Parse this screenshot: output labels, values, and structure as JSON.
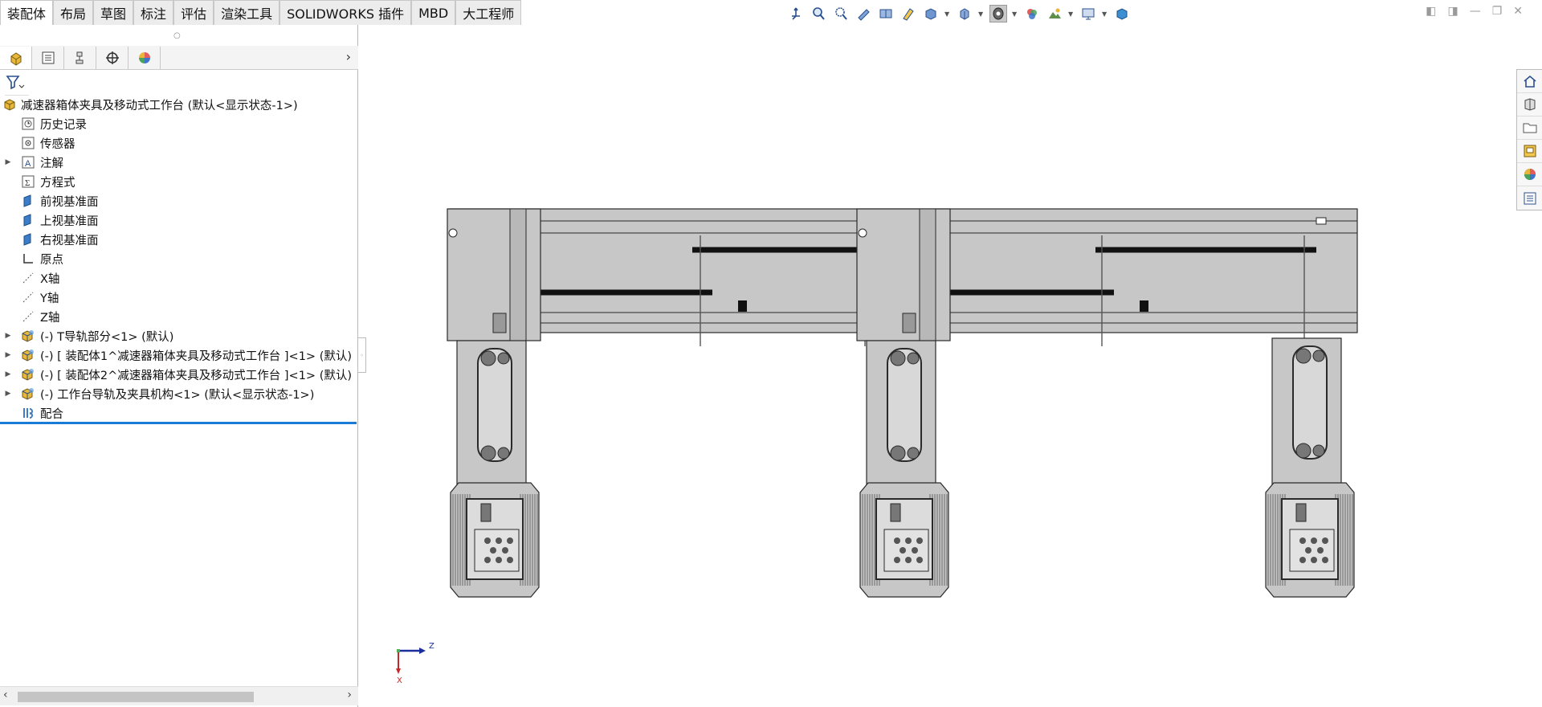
{
  "command_tabs": [
    "装配体",
    "布局",
    "草图",
    "标注",
    "评估",
    "渲染工具",
    "SOLIDWORKS 插件",
    "MBD",
    "大工程师"
  ],
  "heads_up_toolbar": {
    "icons": [
      "view-orientation-icon",
      "zoom-to-fit-icon",
      "zoom-to-area-icon",
      "previous-view-icon",
      "section-view-icon",
      "dynamic-annotation-icon",
      "view-orientation-cube-icon",
      "display-style-icon",
      "hide-show-items-icon",
      "edit-appearance-icon",
      "apply-scene-icon",
      "view-settings-icon",
      "display-pane-icon"
    ]
  },
  "panel": {
    "tabs": [
      "featuremanager-icon",
      "propertymanager-icon",
      "configurationmanager-icon",
      "dimxpertmanager-icon",
      "displaymanager-icon"
    ],
    "tree": {
      "root": "减速器箱体夹具及移动式工作台 (默认<显示状态-1>)",
      "items": [
        {
          "label": "历史记录",
          "icon": "history-icon",
          "expandable": false
        },
        {
          "label": "传感器",
          "icon": "sensor-icon",
          "expandable": false
        },
        {
          "label": "注解",
          "icon": "annotations-icon",
          "expandable": true
        },
        {
          "label": "方程式",
          "icon": "equations-icon",
          "expandable": false
        },
        {
          "label": "前视基准面",
          "icon": "plane-icon",
          "expandable": false
        },
        {
          "label": "上视基准面",
          "icon": "plane-icon",
          "expandable": false
        },
        {
          "label": "右视基准面",
          "icon": "plane-icon",
          "expandable": false
        },
        {
          "label": "原点",
          "icon": "origin-icon",
          "expandable": false
        },
        {
          "label": "X轴",
          "icon": "axis-icon",
          "expandable": false
        },
        {
          "label": "Y轴",
          "icon": "axis-icon",
          "expandable": false
        },
        {
          "label": "Z轴",
          "icon": "axis-icon",
          "expandable": false
        },
        {
          "label": "(-) T导轨部分<1> (默认)",
          "icon": "subassembly-icon",
          "expandable": true
        },
        {
          "label": "(-) [ 装配体1^减速器箱体夹具及移动式工作台 ]<1> (默认)",
          "icon": "subassembly-icon",
          "expandable": true
        },
        {
          "label": "(-) [ 装配体2^减速器箱体夹具及移动式工作台 ]<1> (默认)",
          "icon": "subassembly-icon",
          "expandable": true
        },
        {
          "label": "(-) 工作台导轨及夹具机构<1> (默认<显示状态-1>)",
          "icon": "subassembly-icon",
          "expandable": true
        },
        {
          "label": "配合",
          "icon": "mates-icon",
          "expandable": false
        }
      ]
    }
  },
  "task_pane": [
    "solidworks-resources-icon",
    "design-library-icon",
    "file-explorer-icon",
    "view-palette-icon",
    "appearances-icon",
    "custom-properties-icon"
  ],
  "triad": {
    "z_label": "Z",
    "x_label": "X"
  }
}
